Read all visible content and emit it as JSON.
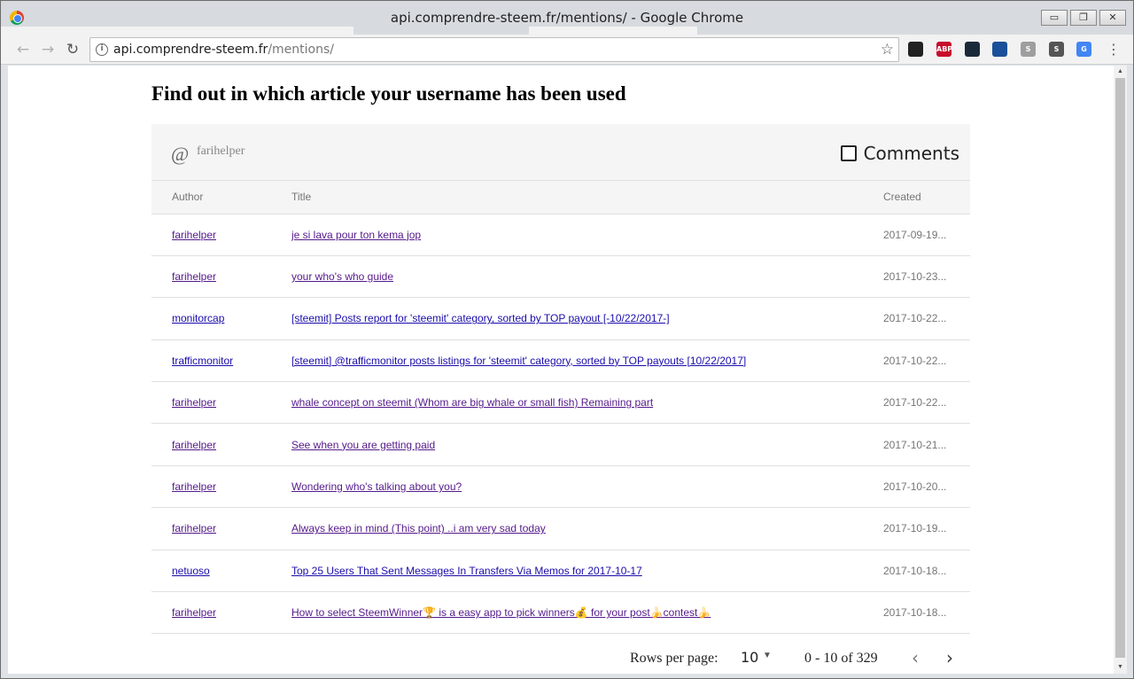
{
  "window": {
    "title": "api.comprendre-steem.fr/mentions/ - Google Chrome",
    "minimize": "▭",
    "restore": "❐",
    "close": "✕"
  },
  "toolbar": {
    "url_host": "api.comprendre-steem.fr",
    "url_path": "/mentions/",
    "extensions": [
      {
        "name": "chrome-ext-icon",
        "label": "",
        "color": "#222222"
      },
      {
        "name": "abp-icon",
        "label": "ABP",
        "color": "#c70d2c"
      },
      {
        "name": "ext-dark-icon",
        "label": "",
        "color": "#1b2a3a"
      },
      {
        "name": "steem-icon",
        "label": "",
        "color": "#1a5099"
      },
      {
        "name": "s-icon",
        "label": "S",
        "color": "#9e9e9e"
      },
      {
        "name": "s-dark-icon",
        "label": "S",
        "color": "#555555"
      },
      {
        "name": "translate-icon",
        "label": "G",
        "color": "#4285f4"
      }
    ]
  },
  "page": {
    "title": "Find out in which article your username has been used"
  },
  "search": {
    "at": "@",
    "value": "farihelper",
    "comments_label": "Comments"
  },
  "table": {
    "headers": {
      "author": "Author",
      "title": "Title",
      "created": "Created"
    },
    "rows": [
      {
        "author": "farihelper",
        "title": "je si lava pour ton kema jop",
        "created": "2017-09-19...",
        "visited": true
      },
      {
        "author": "farihelper",
        "title": "your who's who guide",
        "created": "2017-10-23...",
        "visited": true
      },
      {
        "author": "monitorcap",
        "title": "[steemit] Posts report for 'steemit' category, sorted by TOP payout [-10/22/2017-]",
        "created": "2017-10-22...",
        "visited": false
      },
      {
        "author": "trafficmonitor",
        "title": "[steemit] @trafficmonitor posts listings for 'steemit' category, sorted by TOP payouts [10/22/2017]",
        "created": "2017-10-22...",
        "visited": false
      },
      {
        "author": "farihelper",
        "title": "whale concept on steemit (Whom are big whale or small fish) Remaining part",
        "created": "2017-10-22...",
        "visited": true
      },
      {
        "author": "farihelper",
        "title": "See when you are getting paid",
        "created": "2017-10-21...",
        "visited": true
      },
      {
        "author": "farihelper",
        "title": "Wondering who's talking about you?",
        "created": "2017-10-20...",
        "visited": true
      },
      {
        "author": "farihelper",
        "title": "Always keep in mind (This point) ..i am very sad today",
        "created": "2017-10-19...",
        "visited": true
      },
      {
        "author": "netuoso",
        "title": "Top 25 Users That Sent Messages In Transfers Via Memos for 2017-10-17",
        "created": "2017-10-18...",
        "visited": false
      },
      {
        "author": "farihelper",
        "title": "How to select SteemWinner🏆 is a easy app to pick winners💰 for your post🍌contest🍌",
        "created": "2017-10-18...",
        "visited": true
      }
    ]
  },
  "pagination": {
    "rows_per_page_label": "Rows per page:",
    "rows_per_page": "10",
    "range": "0 - 10 of 329"
  }
}
